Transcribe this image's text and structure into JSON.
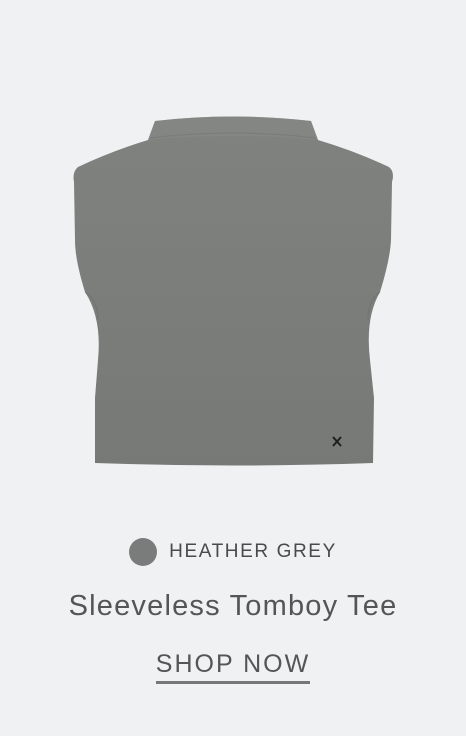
{
  "product": {
    "image_alt": "Sleeveless Tomboy Tee in Heather Grey",
    "color": {
      "name": "HEATHER GREY",
      "swatch_hex": "#7a7c7c"
    },
    "title": "Sleeveless Tomboy Tee",
    "cta_label": "SHOP NOW",
    "logo_icon": "x-mark-logo-icon"
  },
  "colors": {
    "background": "#f0f1f2",
    "garment": "#7b7d7c",
    "text": "#555555"
  }
}
